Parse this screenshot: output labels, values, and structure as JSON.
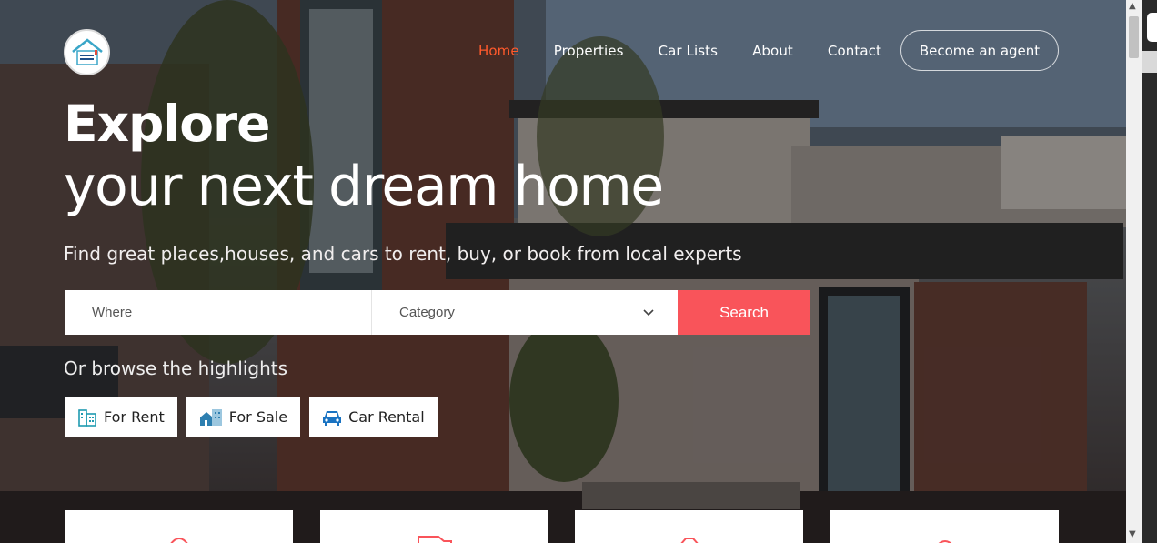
{
  "nav": {
    "logo_name": "house-logo",
    "items": [
      {
        "label": "Home",
        "active": true
      },
      {
        "label": "Properties",
        "active": false
      },
      {
        "label": "Car Lists",
        "active": false
      },
      {
        "label": "About",
        "active": false
      },
      {
        "label": "Contact",
        "active": false
      }
    ],
    "agent_button": "Become an agent",
    "active_color": "#ff5a2c"
  },
  "hero": {
    "title_bold": "Explore",
    "title_light": "your next dream home",
    "subtitle": "Find great places,houses, and cars to rent, buy, or book from local experts"
  },
  "search": {
    "where_placeholder": "Where",
    "category_label": "Category",
    "button_label": "Search",
    "button_color": "#f9545a"
  },
  "highlights": {
    "heading": "Or browse the highlights",
    "chips": [
      {
        "label": "For Rent",
        "icon": "apartment-building-icon"
      },
      {
        "label": "For Sale",
        "icon": "house-for-sale-icon"
      },
      {
        "label": "Car Rental",
        "icon": "car-icon"
      }
    ]
  },
  "cards": [
    {
      "icon": "card-icon-1"
    },
    {
      "icon": "truck-icon"
    },
    {
      "icon": "card-icon-3"
    },
    {
      "icon": "card-icon-4"
    }
  ]
}
